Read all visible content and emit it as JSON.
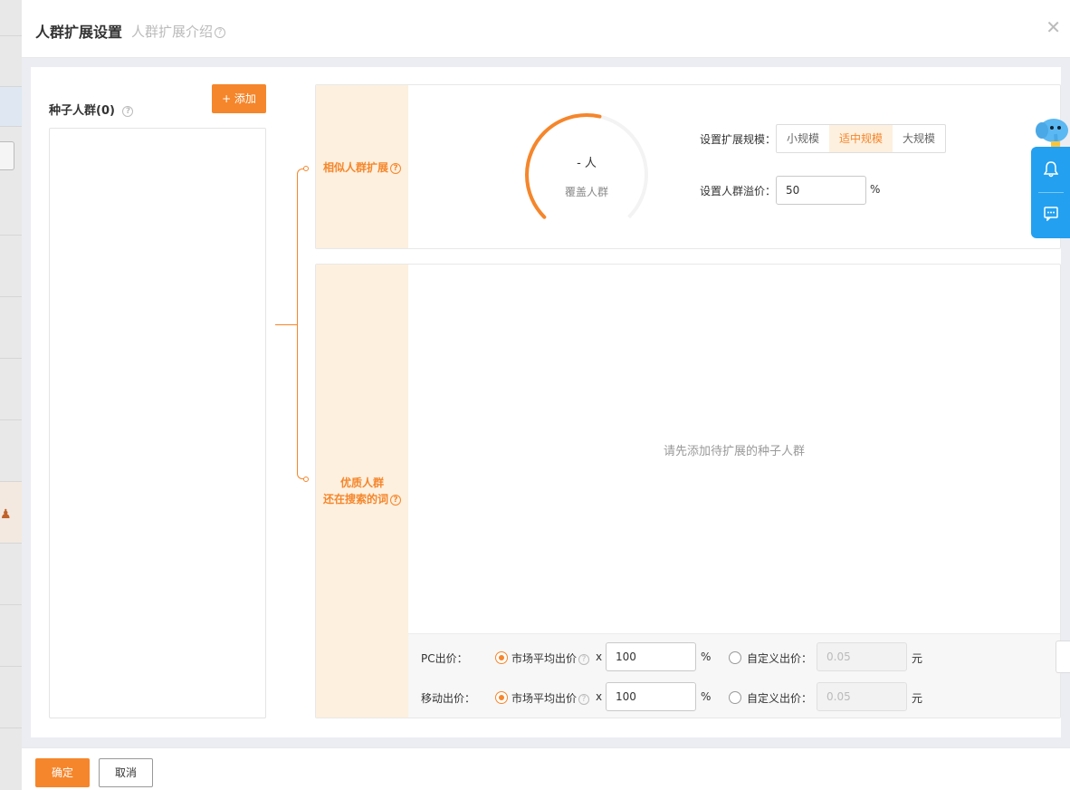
{
  "header": {
    "title": "人群扩展设置",
    "subtitle": "人群扩展介绍",
    "close_glyph": "✕"
  },
  "seed": {
    "title": "种子人群(0)",
    "add_button": "+ 添加"
  },
  "similar": {
    "label": "相似人群扩展",
    "gauge_value": "- 人",
    "gauge_label": "覆盖人群",
    "scale_label": "设置扩展规模：",
    "scale_options": [
      "小规模",
      "适中规模",
      "大规模"
    ],
    "selected_scale": "适中规模",
    "premium_label": "设置人群溢价：",
    "premium_value": "50",
    "premium_unit": "%"
  },
  "quality": {
    "label_line1": "优质人群",
    "label_line2": "还在搜索的词",
    "empty_text": "请先添加待扩展的种子人群",
    "bids": [
      {
        "label": "PC出价：",
        "market_label": "市场平均出价",
        "multiplier": "x",
        "market_value": "100",
        "market_unit": "%",
        "custom_label": "自定义出价：",
        "custom_placeholder": "0.05",
        "custom_unit": "元"
      },
      {
        "label": "移动出价：",
        "market_label": "市场平均出价",
        "multiplier": "x",
        "market_value": "100",
        "market_unit": "%",
        "custom_label": "自定义出价：",
        "custom_placeholder": "0.05",
        "custom_unit": "元"
      }
    ]
  },
  "footer": {
    "ok": "确定",
    "cancel": "取消"
  },
  "colors": {
    "accent": "#f5862b",
    "label_bg": "#fdf0df",
    "float_blue": "#23a0f0"
  },
  "icons": [
    "question-icon",
    "close-icon",
    "bell-icon",
    "message-icon",
    "mascot-icon"
  ]
}
